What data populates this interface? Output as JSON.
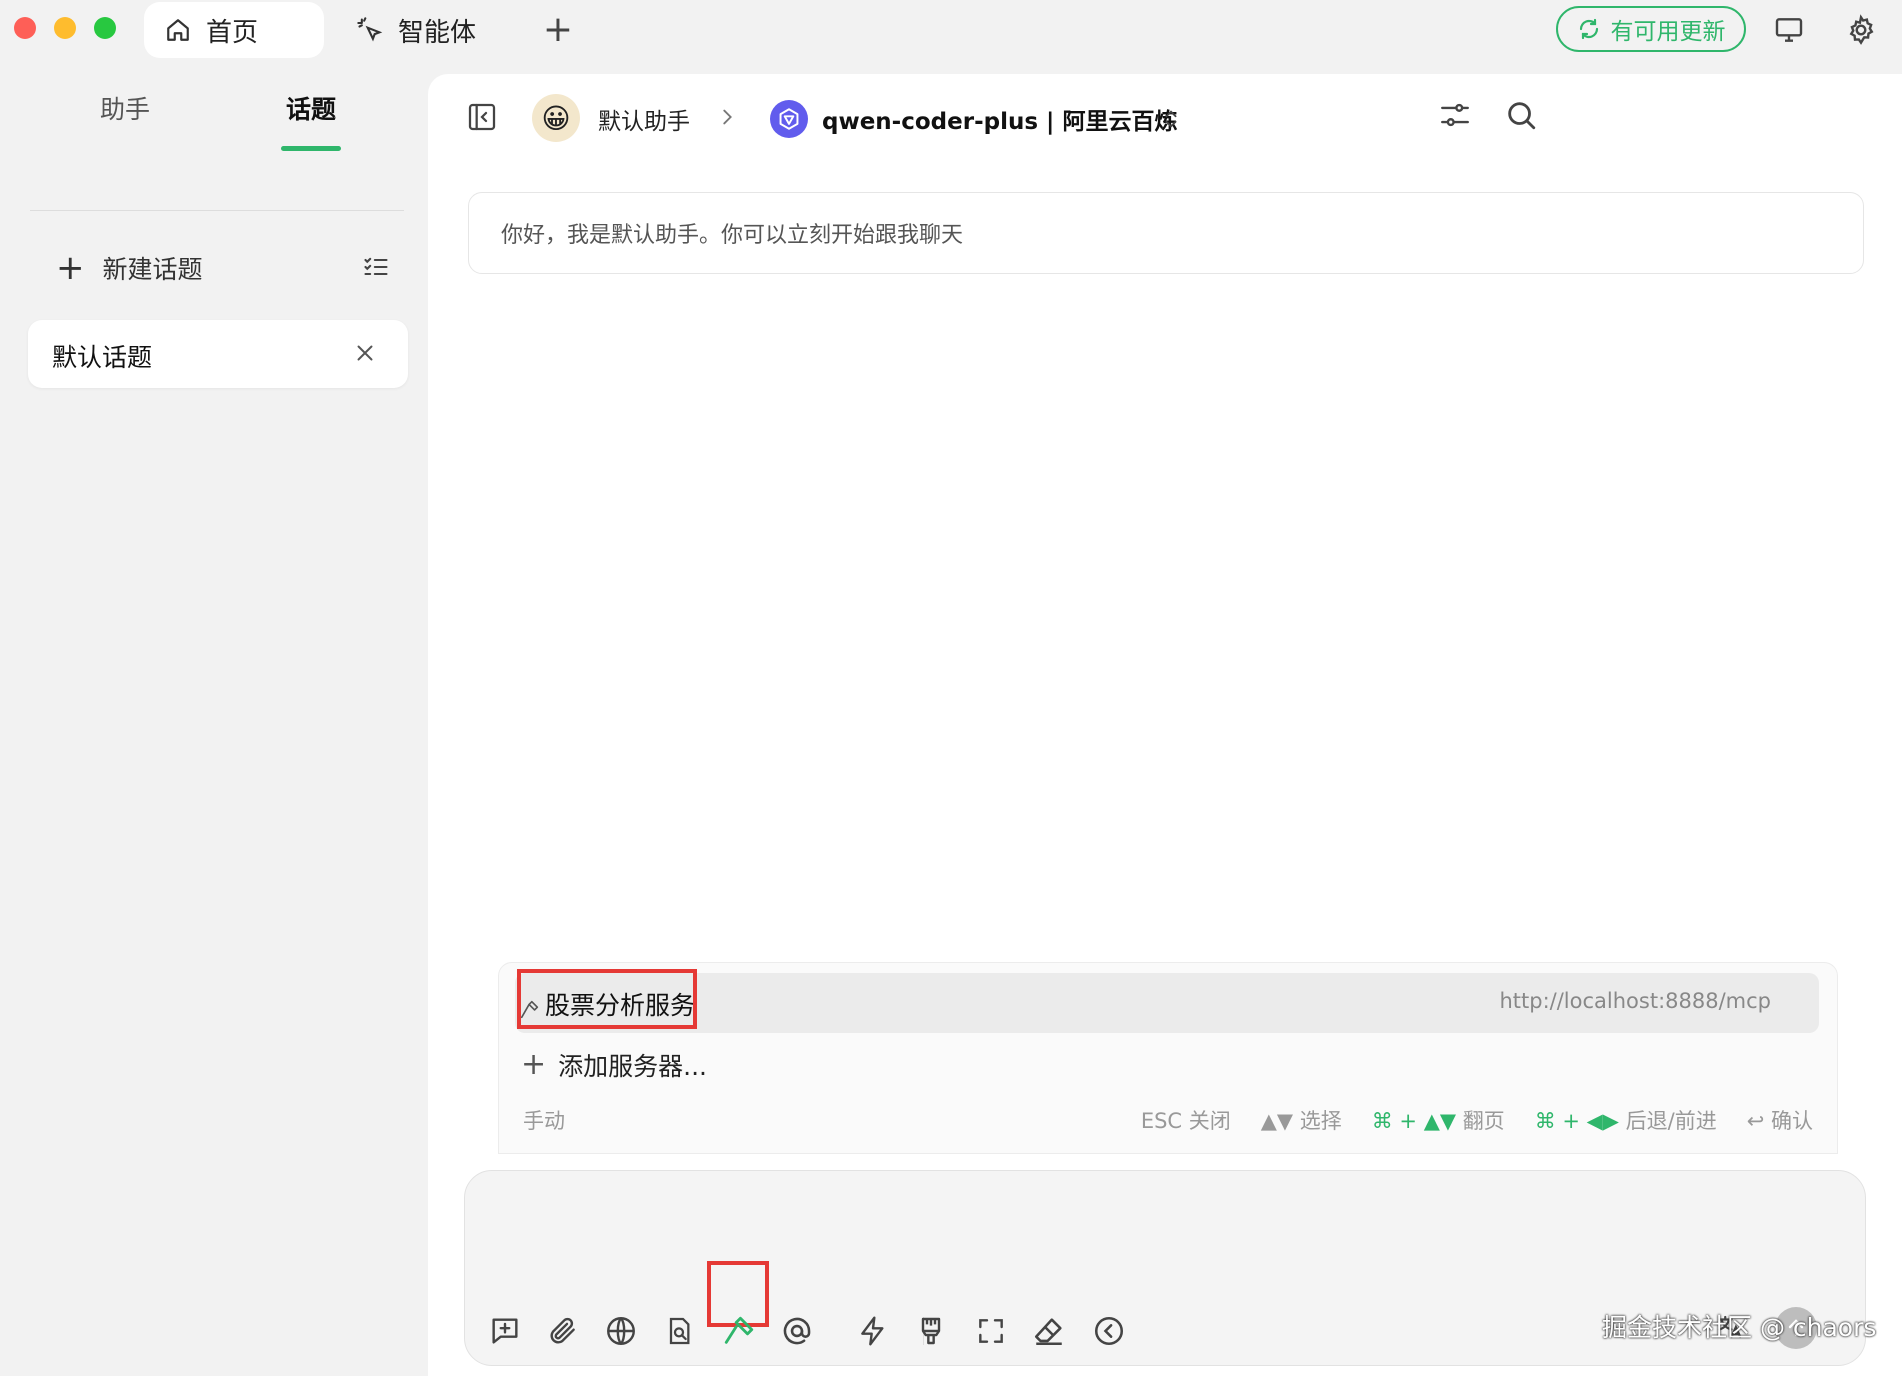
{
  "titlebar": {
    "tabs": [
      {
        "label": "首页",
        "icon": "home-icon"
      },
      {
        "label": "智能体",
        "icon": "sparkle-cursor-icon"
      }
    ],
    "add_tab": "+",
    "update_label": "有可用更新"
  },
  "sidebar": {
    "tabs": [
      "助手",
      "话题"
    ],
    "active_tab": "话题",
    "new_topic_label": "新建话题",
    "topics": [
      {
        "label": "默认话题"
      }
    ]
  },
  "header": {
    "assistant_name": "默认助手",
    "assistant_avatar": "😀",
    "model_name": "qwen-coder-plus | 阿里云百炼"
  },
  "chat": {
    "welcome_message": "你好，我是默认助手。你可以立刻开始跟我聊天"
  },
  "mcp_popup": {
    "servers": [
      {
        "name": "股票分析服务",
        "url": "http://localhost:8888/mcp",
        "selected": true
      }
    ],
    "add_server_label": "添加服务器...",
    "mode_label": "手动",
    "hints": {
      "close": "ESC 关闭",
      "select_keys": "▲▼",
      "select": "选择",
      "page_keys": "⌘ + ▲▼",
      "page": "翻页",
      "nav_keys": "⌘ + ◀▶",
      "nav": "后退/前进",
      "confirm_key": "↩",
      "confirm": "确认"
    }
  },
  "input": {
    "toolbar_icons": [
      "new-topic-icon",
      "attachment-icon",
      "web-search-icon",
      "knowledge-base-icon",
      "mcp-tools-icon",
      "mention-icon",
      "quick-phrase-icon",
      "clear-context-icon",
      "expand-icon",
      "eraser-icon",
      "collapse-back-icon",
      "translate-icon",
      "send-icon"
    ]
  },
  "watermark": "掘金技术社区 @ chaors",
  "colors": {
    "accent": "#2fb66b",
    "highlight": "#e53935",
    "model_logo": "#615ced"
  }
}
